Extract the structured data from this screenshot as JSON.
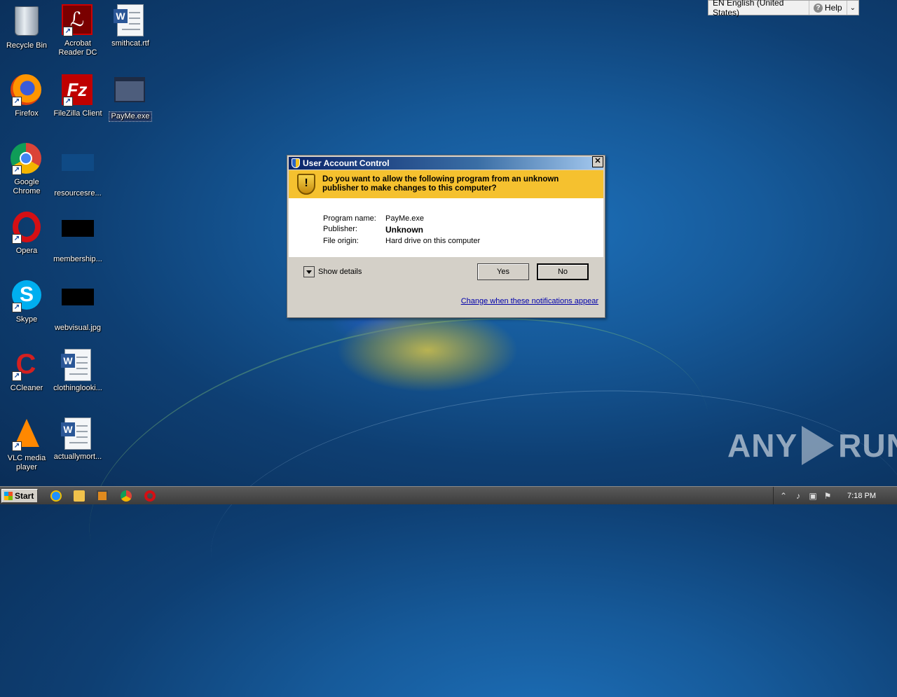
{
  "desktop": {
    "icons": [
      {
        "label": "Recycle Bin",
        "icon": "recycle-bin-icon"
      },
      {
        "label": "Acrobat Reader DC",
        "icon": "acrobat-reader-icon"
      },
      {
        "label": "smithcat.rtf",
        "icon": "word-document-icon"
      },
      {
        "label": "Firefox",
        "icon": "firefox-icon"
      },
      {
        "label": "FileZilla Client",
        "icon": "filezilla-icon"
      },
      {
        "label": "PayMe.exe",
        "icon": "executable-icon"
      },
      {
        "label": "Google Chrome",
        "icon": "chrome-icon"
      },
      {
        "label": "resourcesre...",
        "icon": "file-icon"
      },
      {
        "label": "Opera",
        "icon": "opera-icon"
      },
      {
        "label": "membership...",
        "icon": "image-file-icon"
      },
      {
        "label": "Skype",
        "icon": "skype-icon"
      },
      {
        "label": "webvisual.jpg",
        "icon": "image-file-icon"
      },
      {
        "label": "CCleaner",
        "icon": "ccleaner-icon"
      },
      {
        "label": "clothinglooki...",
        "icon": "word-document-icon"
      },
      {
        "label": "VLC media player",
        "icon": "vlc-icon"
      },
      {
        "label": "actuallymort...",
        "icon": "word-document-icon"
      }
    ]
  },
  "language_bar": {
    "language": "EN English (United States)",
    "help": "Help"
  },
  "uac": {
    "title": "User Account Control",
    "question": "Do you want to allow the following program from an unknown publisher to make changes to this computer?",
    "program_name_label": "Program name:",
    "program_name_value": "PayMe.exe",
    "publisher_label": "Publisher:",
    "publisher_value": "Unknown",
    "file_origin_label": "File origin:",
    "file_origin_value": "Hard drive on this computer",
    "show_details": "Show details",
    "yes": "Yes",
    "no": "No",
    "change_link": "Change when these notifications appear"
  },
  "watermark": {
    "left": "ANY",
    "right": "RUN"
  },
  "taskbar": {
    "start": "Start",
    "clock": "7:18 PM"
  },
  "colors": {
    "uac_banner": "#f5c12f",
    "title_bar": "#0a246a",
    "link": "#0000aa"
  }
}
